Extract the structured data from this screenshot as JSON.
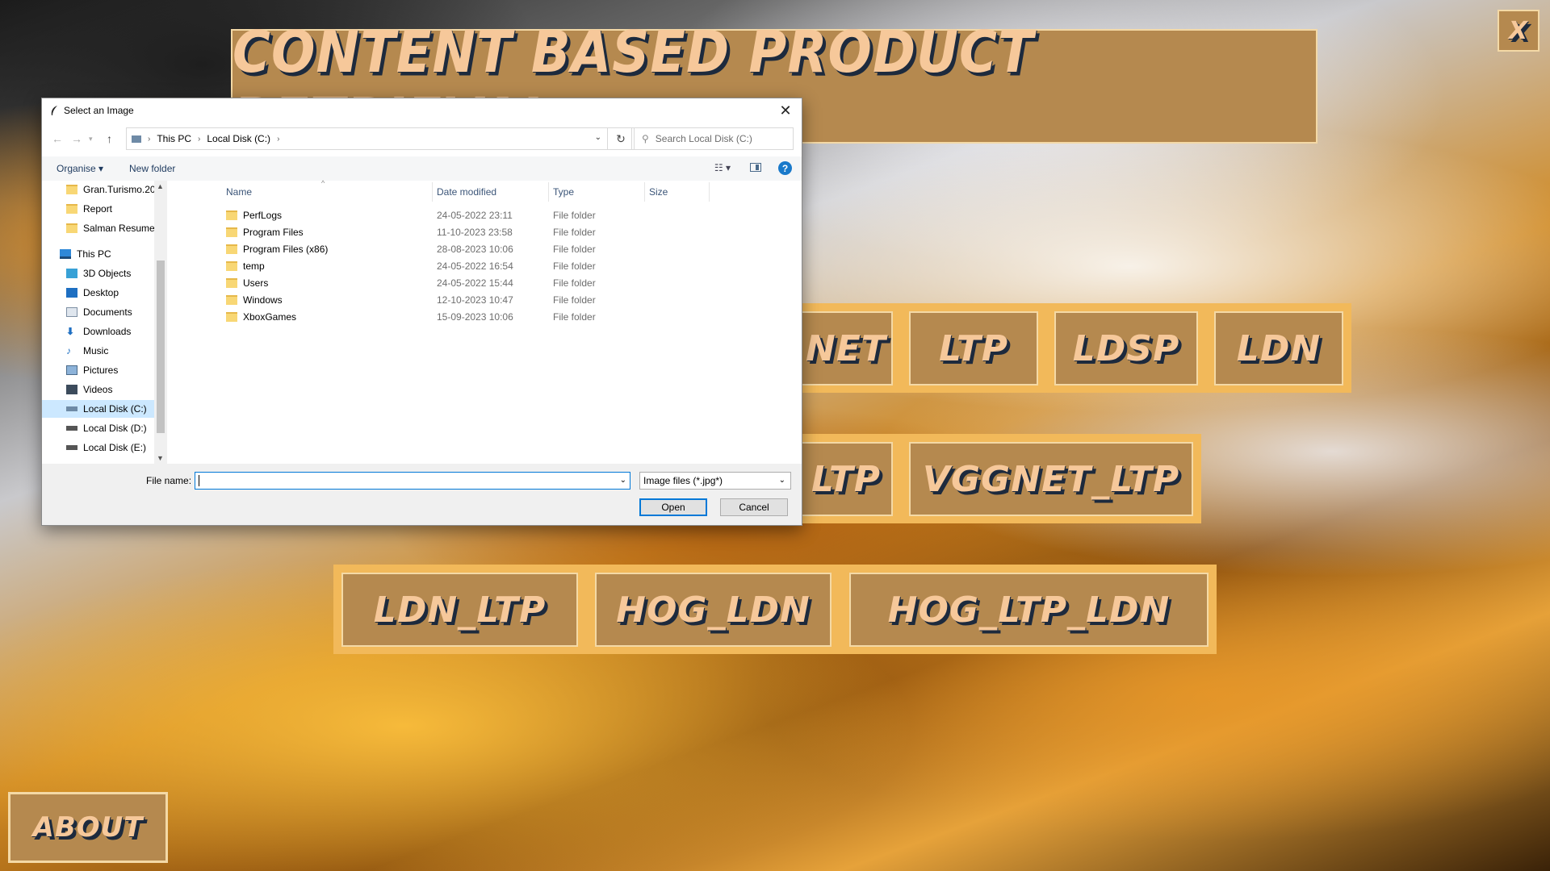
{
  "app": {
    "title": "CONTENT BASED PRODUCT RETRIEVAL",
    "close_label": "X",
    "about_label": "ABOUT",
    "row1": [
      "NET",
      "LTP",
      "LDSP",
      "LDN"
    ],
    "row2": [
      "LTP",
      "VGGNET_LTP"
    ],
    "row3": [
      "LDN_LTP",
      "HOG_LDN",
      "HOG_LTP_LDN"
    ]
  },
  "dialog": {
    "title": "Select an Image",
    "breadcrumb": [
      "This PC",
      "Local Disk (C:)"
    ],
    "search_placeholder": "Search Local Disk (C:)",
    "toolbar": {
      "organise": "Organise",
      "new_folder": "New folder",
      "help": "?"
    },
    "tree": [
      {
        "label": "Gran.Turismo.20",
        "icon": "folder-icon"
      },
      {
        "label": "Report",
        "icon": "folder-icon"
      },
      {
        "label": "Salman Resume",
        "icon": "folder-icon"
      },
      {
        "label": "This PC",
        "icon": "computer-icon"
      },
      {
        "label": "3D Objects",
        "icon": "3d-objects-icon"
      },
      {
        "label": "Desktop",
        "icon": "desktop-icon"
      },
      {
        "label": "Documents",
        "icon": "documents-icon"
      },
      {
        "label": "Downloads",
        "icon": "downloads-icon"
      },
      {
        "label": "Music",
        "icon": "music-icon"
      },
      {
        "label": "Pictures",
        "icon": "pictures-icon"
      },
      {
        "label": "Videos",
        "icon": "videos-icon"
      },
      {
        "label": "Local Disk (C:)",
        "icon": "drive-icon",
        "selected": true
      },
      {
        "label": "Local Disk (D:)",
        "icon": "drive-icon"
      },
      {
        "label": "Local Disk (E:)",
        "icon": "drive-icon"
      }
    ],
    "columns": [
      "Name",
      "Date modified",
      "Type",
      "Size"
    ],
    "files": [
      {
        "name": "PerfLogs",
        "date": "24-05-2022 23:11",
        "type": "File folder"
      },
      {
        "name": "Program Files",
        "date": "11-10-2023 23:58",
        "type": "File folder"
      },
      {
        "name": "Program Files (x86)",
        "date": "28-08-2023 10:06",
        "type": "File folder"
      },
      {
        "name": "temp",
        "date": "24-05-2022 16:54",
        "type": "File folder"
      },
      {
        "name": "Users",
        "date": "24-05-2022 15:44",
        "type": "File folder"
      },
      {
        "name": "Windows",
        "date": "12-10-2023 10:47",
        "type": "File folder"
      },
      {
        "name": "XboxGames",
        "date": "15-09-2023 10:06",
        "type": "File folder"
      }
    ],
    "file_name_label": "File name:",
    "file_name_value": "",
    "file_type": "Image files (*.jpg*)",
    "open_label": "Open",
    "cancel_label": "Cancel"
  },
  "colors": {
    "button_fill": "#b5894f",
    "button_border": "#f4d9a6",
    "row_band": "#f2b95a",
    "text": "#f6c89a",
    "shadow": "#1d2a3d",
    "accent": "#0078d7"
  }
}
